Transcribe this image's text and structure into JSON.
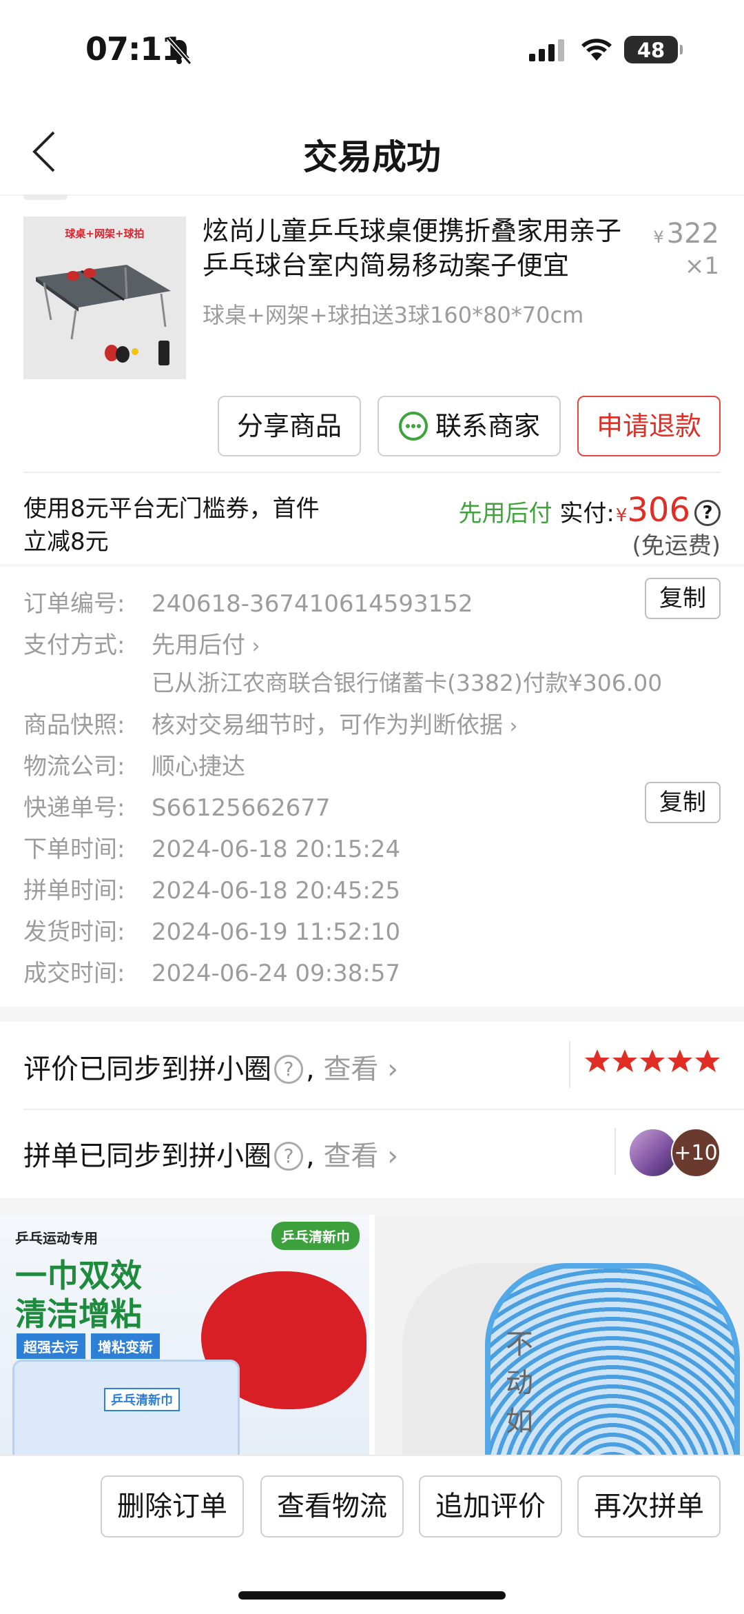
{
  "status_bar": {
    "time": "07:11",
    "battery": "48"
  },
  "nav": {
    "title": "交易成功"
  },
  "product": {
    "image_tag": "球桌+网架+球拍",
    "name": "炫尚儿童乒乓球桌便携折叠家用亲子乒乓球台室内简易移动案子便宜",
    "spec": "球桌+网架+球拍送3球160*80*70cm",
    "price_symbol": "¥",
    "price": "322",
    "quantity": "×1"
  },
  "actions": {
    "share": "分享商品",
    "contact": "联系商家",
    "refund": "申请退款"
  },
  "payment": {
    "coupon": "使用8元平台无门槛券，首件立减8元",
    "pay_later": "先用后付",
    "paid_label": "实付:",
    "currency": "¥",
    "amount": "306",
    "help": "?",
    "shipping": "(免运费)"
  },
  "order_info": {
    "order_no_label": "订单编号:",
    "order_no": "240618-367410614593152",
    "copy": "复制",
    "pay_method_label": "支付方式:",
    "pay_method": "先用后付",
    "pay_detail": "已从浙江农商联合银行储蓄卡(3382)付款¥306.00",
    "snapshot_label": "商品快照:",
    "snapshot": "核对交易细节时，可作为判断依据",
    "logistics_label": "物流公司:",
    "logistics": "顺心捷达",
    "tracking_label": "快递单号:",
    "tracking": "S66125662677",
    "order_time_label": "下单时间:",
    "order_time": "2024-06-18 20:15:24",
    "group_time_label": "拼单时间:",
    "group_time": "2024-06-18 20:45:25",
    "ship_time_label": "发货时间:",
    "ship_time": "2024-06-19 11:52:10",
    "deal_time_label": "成交时间:",
    "deal_time": "2024-06-24 09:38:57"
  },
  "sync": {
    "review_text": "评价已同步到拼小圈",
    "group_text": "拼单已同步到拼小圈",
    "help": "?",
    "comma": ",",
    "view": "查看",
    "rating_stars": 5,
    "avatar_more": "+10"
  },
  "recommendations": {
    "item1_label": "乒乓运动专用",
    "item1_badge": "乒乓清新巾",
    "item1_title_line1": "一巾双效",
    "item1_title_line2": "清洁增粘",
    "item1_chip1": "超强去污",
    "item1_chip2": "增粘变新",
    "item1_pack": "乒乓清新巾",
    "item2_text": "不动如"
  },
  "bottom_bar": {
    "delete": "删除订单",
    "logistics": "查看物流",
    "add_review": "追加评价",
    "regroup": "再次拼单"
  },
  "colors": {
    "accent_red": "#e02e24",
    "pay_later_green": "#3ea33a",
    "star_red": "#e02e24"
  }
}
